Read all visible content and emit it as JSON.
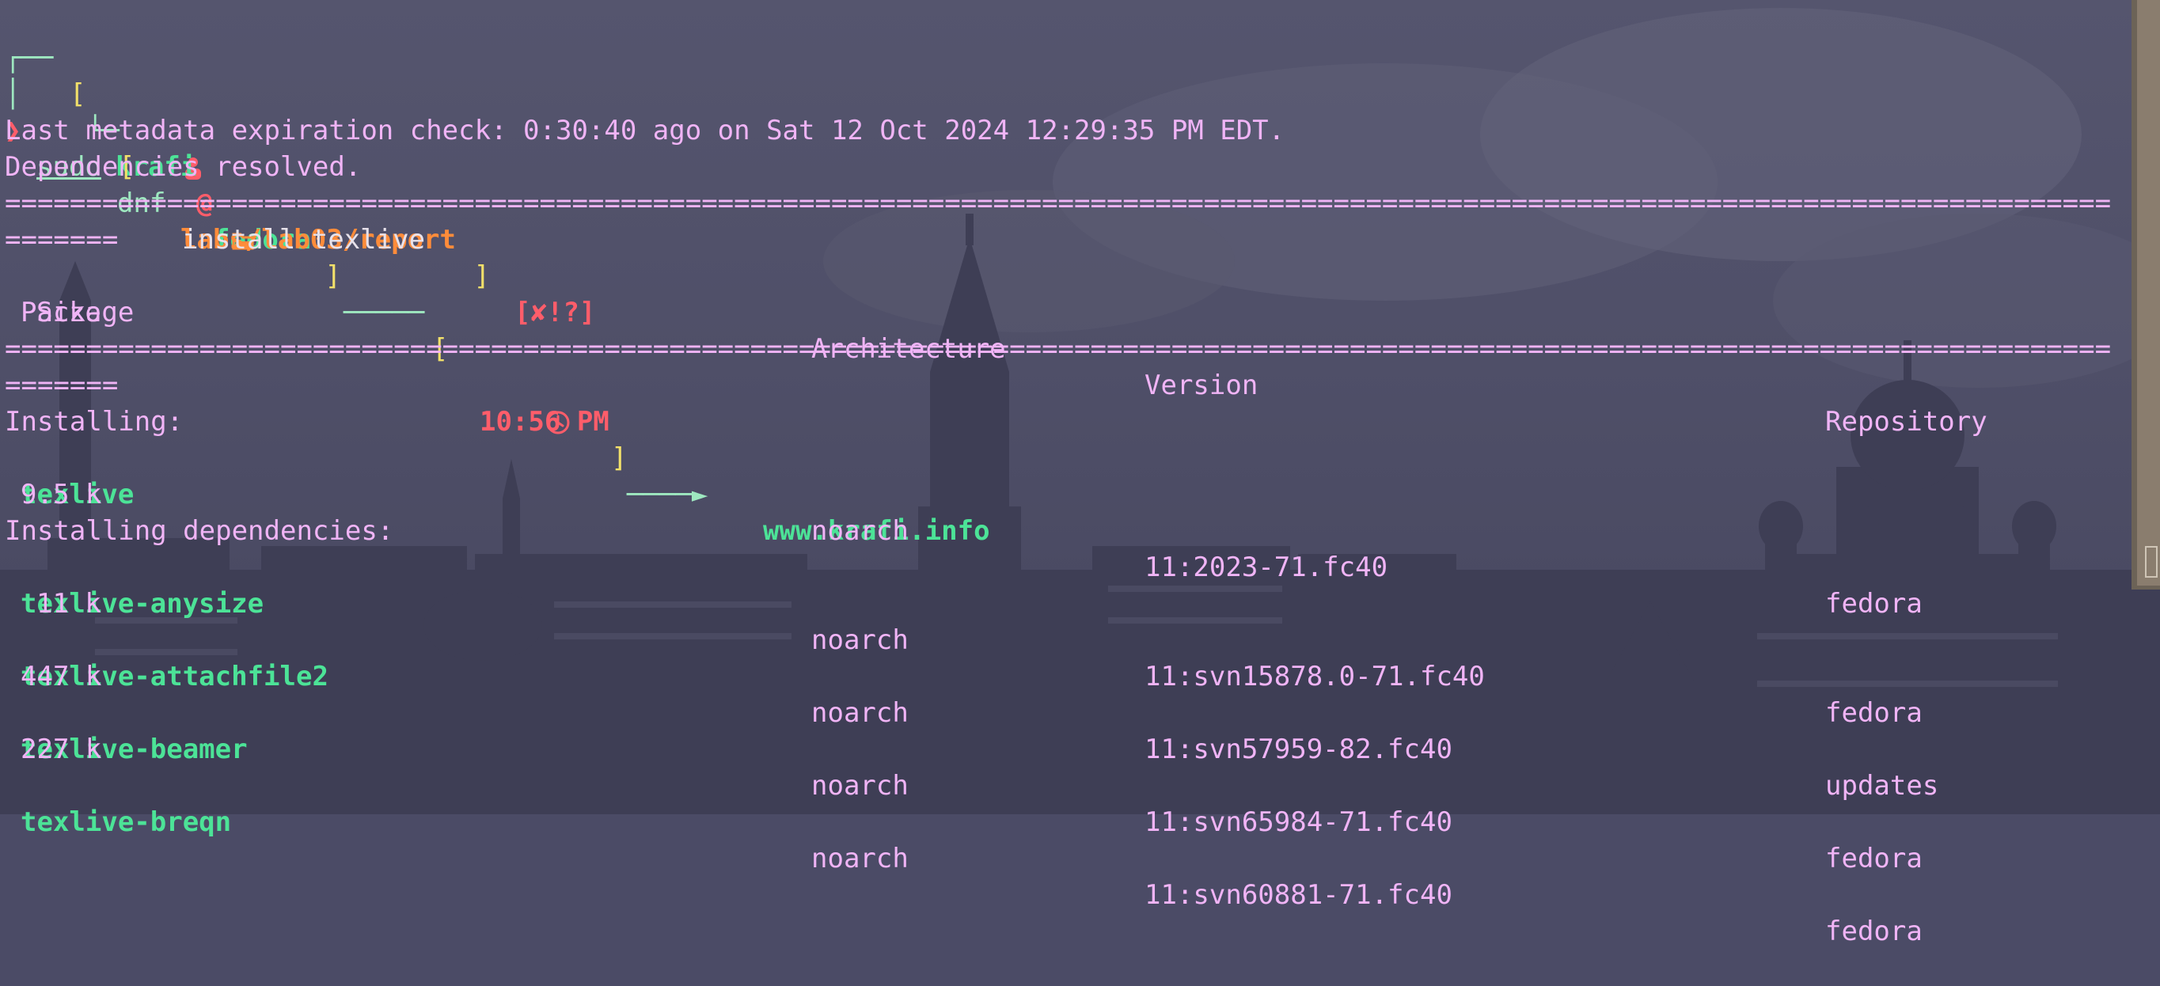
{
  "prompt": {
    "user": "krafi",
    "at": "@",
    "host": "fedora",
    "close_bracket": " ]",
    "time": "10:56 PM",
    "url": "www.krafi.info",
    "path": "labs/lab03/report",
    "path_close": " ]",
    "status": "[✘!?]",
    "arrow": "❯",
    "sudo": "sudo",
    "dnf": "dnf",
    "args": "install texlive"
  },
  "output": {
    "metadata_line": "Last metadata expiration check: 0:30:40 ago on Sat 12 Oct 2024 12:29:35 PM EDT.",
    "deps_line": "Dependencies resolved.",
    "separator_short": "=======",
    "headers": {
      "package": "Package",
      "arch": "Architecture",
      "version": "Version",
      "repo": "Repository",
      "size": "Size"
    },
    "installing_label": "Installing:",
    "deps_label": "Installing dependencies:",
    "packages": [
      {
        "name": "texlive",
        "arch": "noarch",
        "version": "11:2023-71.fc40",
        "repo": "fedora",
        "size": "9.5 k"
      },
      {
        "name": "texlive-anysize",
        "arch": "noarch",
        "version": "11:svn15878.0-71.fc40",
        "repo": "fedora",
        "size": "11 k"
      },
      {
        "name": "texlive-attachfile2",
        "arch": "noarch",
        "version": "11:svn57959-82.fc40",
        "repo": "updates",
        "size": "447 k"
      },
      {
        "name": "texlive-beamer",
        "arch": "noarch",
        "version": "11:svn65984-71.fc40",
        "repo": "fedora",
        "size": "227 k"
      },
      {
        "name": "texlive-breqn",
        "arch": "noarch",
        "version": "11:svn60881-71.fc40",
        "repo": "fedora",
        "size": ""
      }
    ]
  },
  "colors": {
    "background": "#4b4b66",
    "text": "#f0b4f6",
    "package": "#4ce397",
    "user": "#4ce397",
    "time": "#ff5d6a",
    "path": "#ff8c3a",
    "bracket": "#f2e06a"
  },
  "icons": [
    "user-icon",
    "clock-icon",
    "folder-icon"
  ]
}
